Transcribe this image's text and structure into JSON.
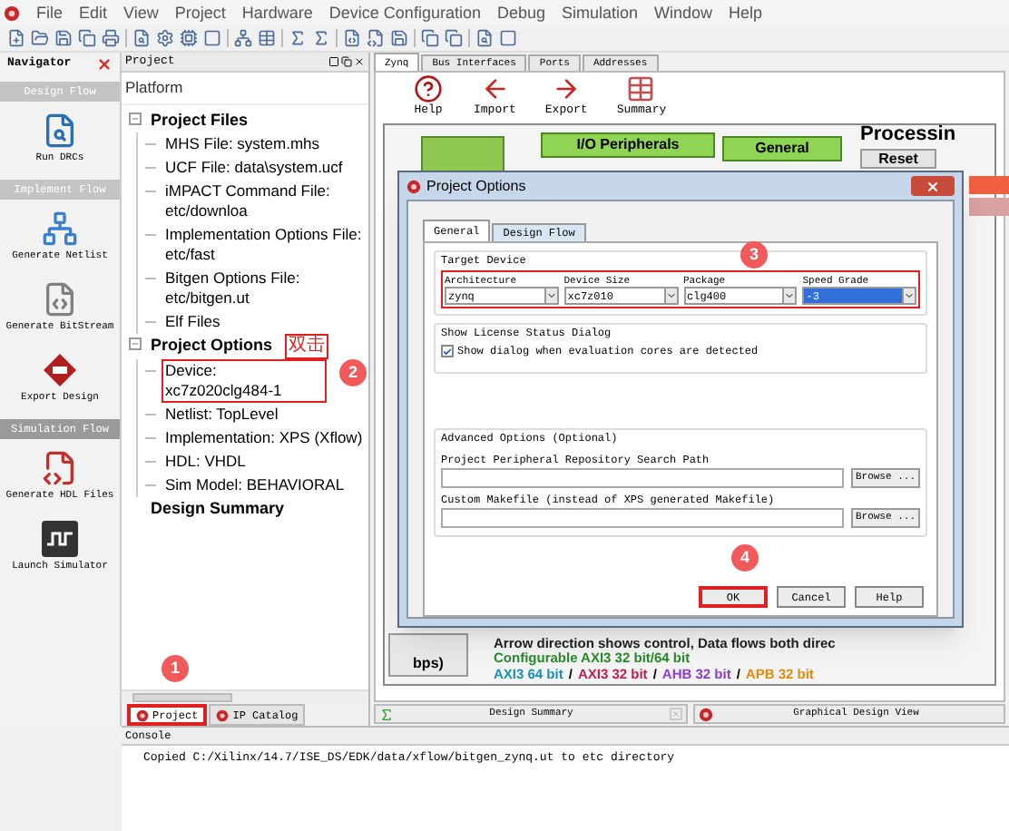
{
  "menu": [
    "File",
    "Edit",
    "View",
    "Project",
    "Hardware",
    "Device Configuration",
    "Debug",
    "Simulation",
    "Window",
    "Help"
  ],
  "navigator": {
    "title": "Navigator",
    "sections": [
      {
        "title": "Design Flow",
        "selected": false,
        "items": [
          {
            "label": "Run DRCs",
            "kind": "drc"
          }
        ]
      },
      {
        "title": "Implement Flow",
        "selected": false,
        "items": [
          {
            "label": "Generate Netlist",
            "kind": "netlist"
          },
          {
            "label": "Generate BitStream",
            "kind": "bitstream"
          },
          {
            "label": "Export Design",
            "kind": "export"
          }
        ]
      },
      {
        "title": "Simulation Flow",
        "selected": true,
        "items": [
          {
            "label": "Generate HDL Files",
            "kind": "hdl"
          },
          {
            "label": "Launch Simulator",
            "kind": "simulator"
          }
        ]
      }
    ]
  },
  "project_panel": {
    "title": "Project",
    "platform": "Platform",
    "tree": [
      {
        "label": "Project Files",
        "expanded": true,
        "highlighted": false,
        "children": [
          {
            "label": "MHS File: system.mhs",
            "highlighted": false
          },
          {
            "label": "UCF File: data\\system.ucf",
            "highlighted": false
          },
          {
            "label": "iMPACT Command File: etc/downloa",
            "highlighted": false
          },
          {
            "label": "Implementation Options File: etc/fast",
            "highlighted": false
          },
          {
            "label": "Bitgen Options File: etc/bitgen.ut",
            "highlighted": false
          },
          {
            "label": "Elf Files",
            "highlighted": false
          }
        ]
      },
      {
        "label": "Project Options",
        "expanded": true,
        "highlighted": false,
        "children": [
          {
            "label": "Device: xc7z020clg484-1",
            "highlighted": true
          },
          {
            "label": "Netlist: TopLevel",
            "highlighted": false
          },
          {
            "label": "Implementation: XPS (Xflow)",
            "highlighted": false
          },
          {
            "label": "HDL: VHDL",
            "highlighted": false
          },
          {
            "label": "Sim Model: BEHAVIORAL",
            "highlighted": false
          }
        ]
      },
      {
        "label": "Design Summary",
        "highlighted": false
      }
    ],
    "tabs": [
      {
        "label": "Project",
        "selected": true,
        "highlighted": true
      },
      {
        "label": "IP Catalog",
        "selected": false,
        "highlighted": false
      }
    ]
  },
  "main": {
    "tabs": [
      {
        "label": "Zynq",
        "selected": true
      },
      {
        "label": "Bus Interfaces",
        "selected": false
      },
      {
        "label": "Ports",
        "selected": false
      },
      {
        "label": "Addresses",
        "selected": false
      }
    ],
    "toolbar": [
      {
        "label": "Help",
        "kind": "help"
      },
      {
        "label": "Import",
        "kind": "import"
      },
      {
        "label": "Export",
        "kind": "export"
      },
      {
        "label": "Summary",
        "kind": "summary"
      }
    ],
    "diagram": {
      "title": "Processin",
      "blocks": [
        "I/O Peripherals",
        "General",
        "Reset"
      ],
      "bps": "bps)",
      "notes": [
        "Arrow direction shows control, Data flows both direc",
        "Configurable AXI3 32 bit/64 bit"
      ],
      "legend": [
        {
          "text": "AXI3 64 bit",
          "color": "#1f8fb0"
        },
        {
          "text": "/",
          "color": "#000000"
        },
        {
          "text": "AXI3 32 bit",
          "color": "#c0204a"
        },
        {
          "text": "/",
          "color": "#000000"
        },
        {
          "text": "AHB 32 bit",
          "color": "#8a3fc8"
        },
        {
          "text": "/",
          "color": "#000000"
        },
        {
          "text": "APB 32 bit",
          "color": "#e08a10"
        }
      ]
    },
    "bottom_tabs": [
      {
        "label": "Design Summary",
        "kind": "summary",
        "closable": true
      },
      {
        "label": "Graphical Design View",
        "kind": "graphical",
        "closable": false
      }
    ]
  },
  "console": {
    "title": "Console",
    "lines": [
      "Copied C:/Xilinx/14.7/ISE_DS/EDK/data/xflow/bitgen_zynq.ut to etc directory"
    ]
  },
  "dialog": {
    "title": "Project Options",
    "tabs": [
      {
        "label": "General",
        "selected": true
      },
      {
        "label": "Design Flow",
        "selected": false
      }
    ],
    "target_device": {
      "title": "Target Device",
      "highlighted": true,
      "fields": [
        {
          "label": "Architecture",
          "value": "zynq",
          "focused": false
        },
        {
          "label": "Device Size",
          "value": "xc7z010",
          "focused": false
        },
        {
          "label": "Package",
          "value": "clg400",
          "focused": false
        },
        {
          "label": "Speed Grade",
          "value": "-3",
          "focused": true
        }
      ]
    },
    "license": {
      "title": "Show License Status Dialog",
      "checkbox": {
        "label": "Show dialog when evaluation cores are detected",
        "checked": true
      }
    },
    "advanced": {
      "title": "Advanced Options (Optional)",
      "paths": [
        {
          "label": "Project Peripheral Repository Search Path",
          "button": "Browse ..."
        },
        {
          "label": "Custom Makefile (instead of XPS generated Makefile)",
          "button": "Browse ..."
        }
      ]
    },
    "buttons": [
      {
        "label": "OK",
        "highlighted": true
      },
      {
        "label": "Cancel",
        "highlighted": false
      },
      {
        "label": "Help",
        "highlighted": false
      }
    ]
  },
  "annotations": {
    "steps": [
      "1",
      "2",
      "3",
      "4"
    ],
    "note": "双击"
  }
}
